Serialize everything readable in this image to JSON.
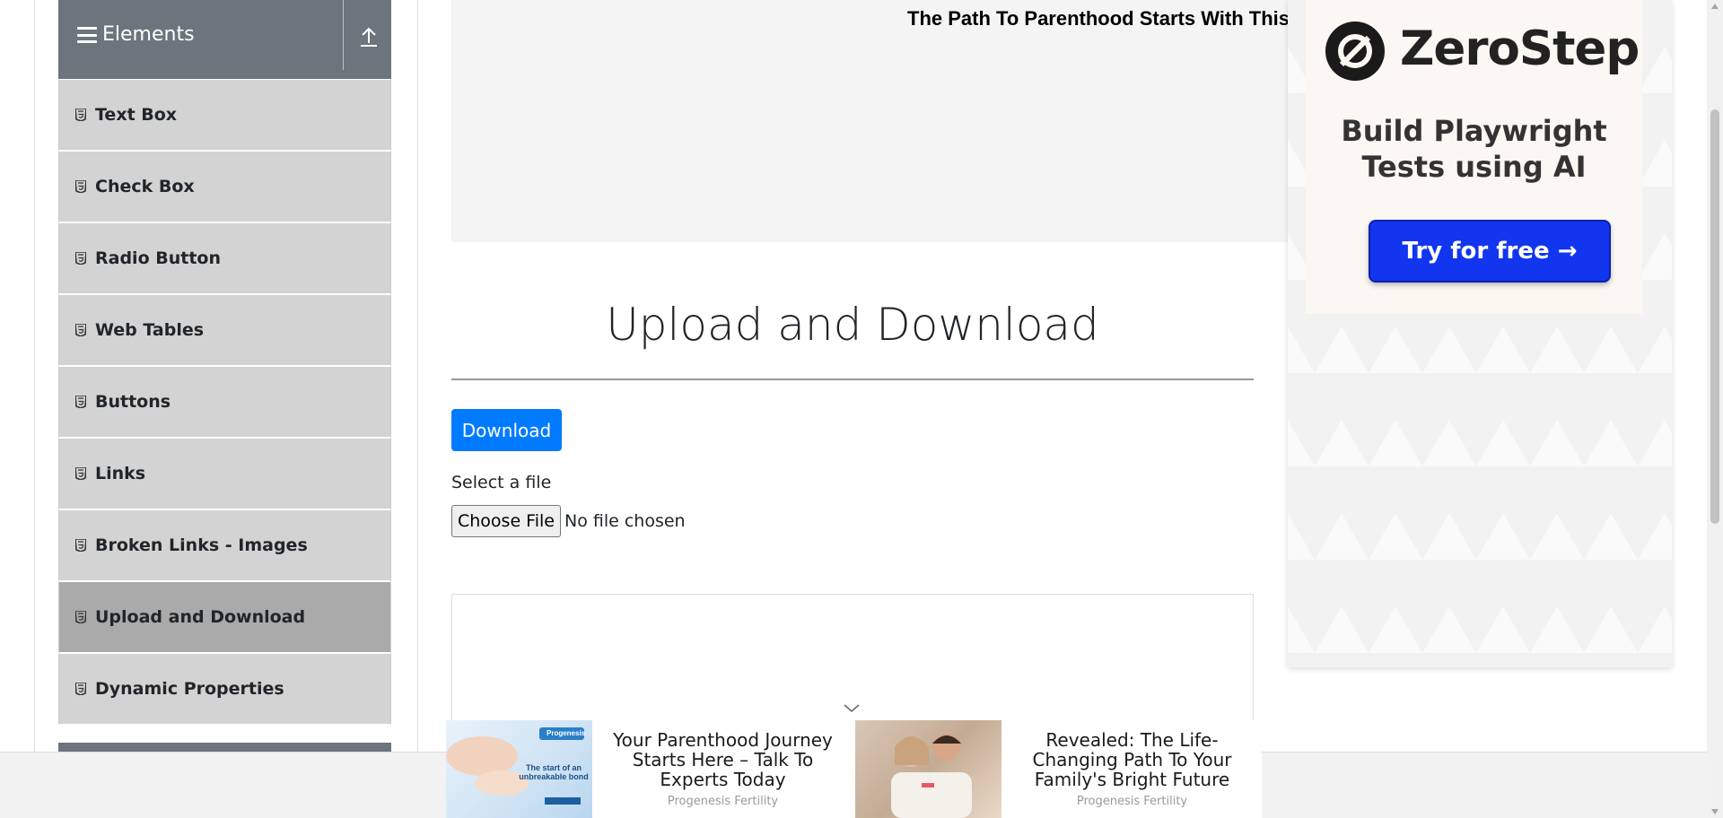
{
  "sidebar": {
    "group_title": "Elements",
    "items": [
      {
        "label": "Text Box"
      },
      {
        "label": "Check Box"
      },
      {
        "label": "Radio Button"
      },
      {
        "label": "Web Tables"
      },
      {
        "label": "Buttons"
      },
      {
        "label": "Links"
      },
      {
        "label": "Broken Links - Images"
      },
      {
        "label": "Upload and Download",
        "active": true
      },
      {
        "label": "Dynamic Properties"
      }
    ]
  },
  "top_ad": {
    "headline": "The Path To Parenthood Starts With This"
  },
  "main": {
    "title": "Upload and Download",
    "download_label": "Download",
    "file_label": "Select a file",
    "choose_file_label": "Choose File",
    "no_file_text": "No file chosen"
  },
  "right_ad": {
    "brand": "ZeroStep",
    "tagline_line1": "Build Playwright",
    "tagline_line2": "Tests using AI",
    "cta": "Try for free →"
  },
  "bottom_ads": [
    {
      "headline": "Your Parenthood Journey Starts Here – Talk To Experts Today",
      "sponsor": "Progenesis Fertility",
      "thumb_brand": "Progenesis",
      "thumb_text": "The start of an unbreakable bond"
    },
    {
      "headline": "Revealed: The Life-Changing Path To Your Family's Bright Future",
      "sponsor": "Progenesis Fertility"
    }
  ],
  "colors": {
    "accent": "#007bff",
    "sidebar_header": "#6c757d",
    "menu_item": "#d3d3d3",
    "menu_item_active": "#aaaaaa",
    "cta": "#1235f0"
  }
}
